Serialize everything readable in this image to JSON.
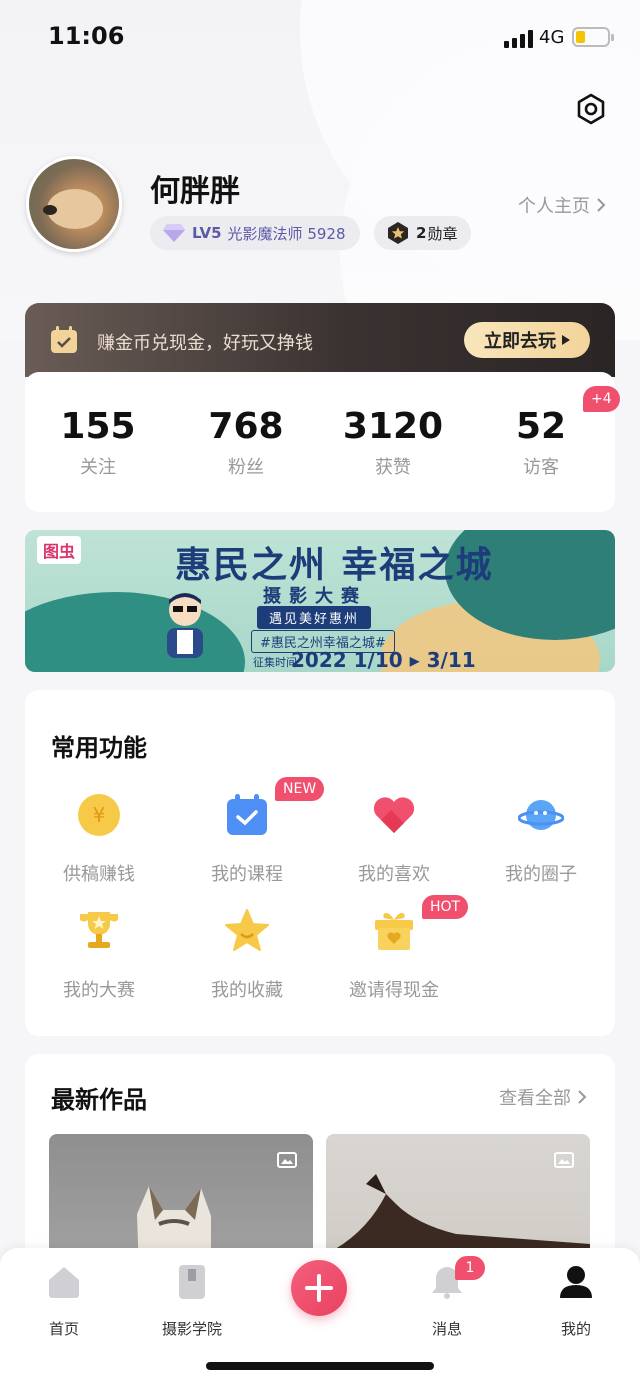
{
  "status": {
    "time": "11:06",
    "network": "4G"
  },
  "profile": {
    "name": "何胖胖",
    "level": "LV5",
    "level_title": "光影魔法师 5928",
    "medal_count": "2",
    "medal_label": "勋章",
    "homepage_link": "个人主页"
  },
  "promo": {
    "text": "赚金币兑现金，好玩又挣钱",
    "button": "立即去玩"
  },
  "stats": [
    {
      "value": "155",
      "label": "关注"
    },
    {
      "value": "768",
      "label": "粉丝"
    },
    {
      "value": "3120",
      "label": "获赞"
    },
    {
      "value": "52",
      "label": "访客",
      "badge": "+4"
    }
  ],
  "banner": {
    "brand": "图虫",
    "title": "惠民之州 幸福之城",
    "subtitle": "摄影大赛",
    "tagline": "遇见美好惠州",
    "hashtag": "#惠民之州幸福之城#",
    "period_label": "征集时间",
    "dates": "2022 1/10 ▸ 3/11"
  },
  "functions": {
    "title": "常用功能",
    "items": [
      {
        "label": "供稿赚钱",
        "icon": "coin-icon"
      },
      {
        "label": "我的课程",
        "icon": "calendar-check-icon",
        "tag": "NEW"
      },
      {
        "label": "我的喜欢",
        "icon": "heart-icon"
      },
      {
        "label": "我的圈子",
        "icon": "planet-icon"
      },
      {
        "label": "我的大赛",
        "icon": "trophy-icon"
      },
      {
        "label": "我的收藏",
        "icon": "star-icon"
      },
      {
        "label": "邀请得现金",
        "icon": "gift-icon",
        "tag": "HOT"
      }
    ]
  },
  "works": {
    "title": "最新作品",
    "see_all": "查看全部"
  },
  "tabbar": {
    "items": [
      {
        "label": "首页",
        "icon": "home-icon"
      },
      {
        "label": "摄影学院",
        "icon": "book-icon"
      },
      {
        "label": "",
        "icon": "plus-icon"
      },
      {
        "label": "消息",
        "icon": "bell-icon",
        "badge": "1"
      },
      {
        "label": "我的",
        "icon": "user-icon"
      }
    ]
  },
  "colors": {
    "accent": "#f0506e",
    "gold": "#f2d39a",
    "muted": "#999999"
  }
}
